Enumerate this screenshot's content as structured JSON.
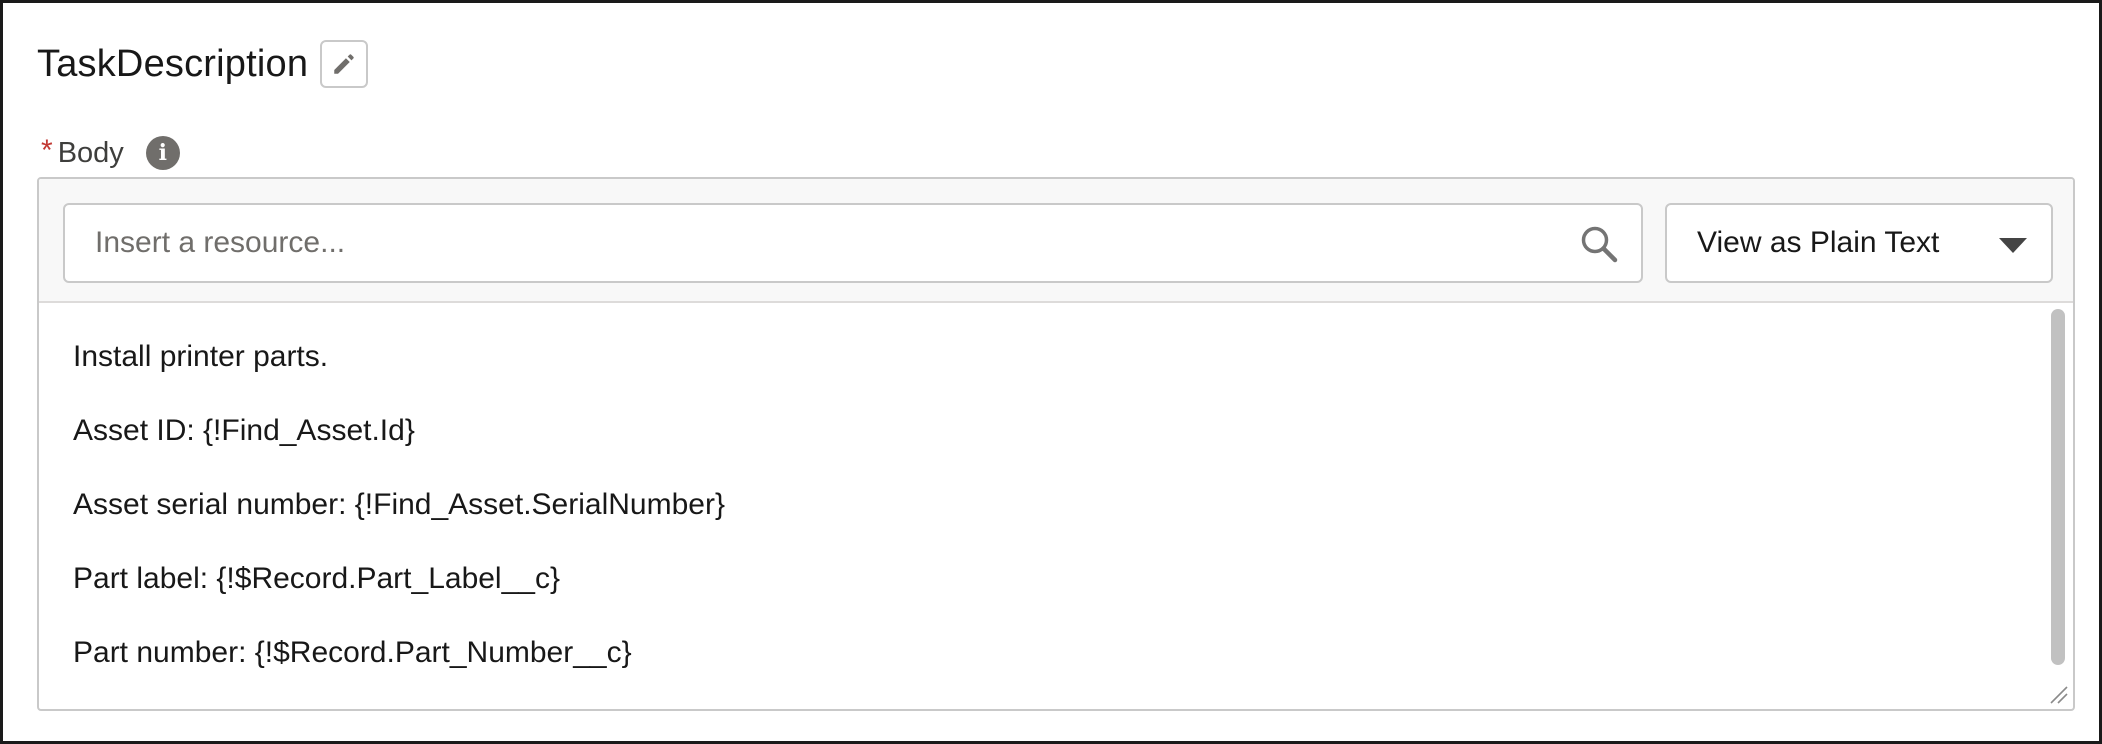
{
  "header": {
    "title": "TaskDescription",
    "edit_icon": "pencil-icon"
  },
  "field": {
    "required_marker": "*",
    "label": "Body",
    "info_icon": "info-icon"
  },
  "toolbar": {
    "search": {
      "placeholder": "Insert a resource...",
      "value": "",
      "icon": "search-icon"
    },
    "view_select": {
      "selected": "View as Plain Text",
      "icon": "chevron-down-icon"
    }
  },
  "body": {
    "lines": [
      "Install printer parts.",
      "Asset ID: {!Find_Asset.Id}",
      "Asset serial number: {!Find_Asset.SerialNumber}",
      "Part label: {!$Record.Part_Label__c}",
      "Part number: {!$Record.Part_Number__c}"
    ]
  },
  "colors": {
    "required": "#c23934",
    "border": "#c9c9c9",
    "toolbar_bg": "#f8f8f8",
    "info_icon_bg": "#706e6b"
  }
}
